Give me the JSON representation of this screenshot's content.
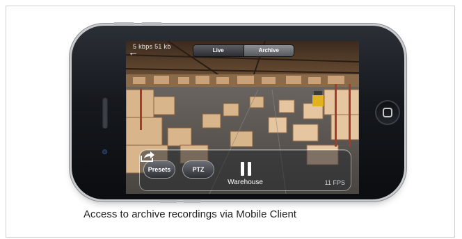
{
  "status_bar": {
    "text": "5 kbps    51 kb"
  },
  "view_switch": {
    "live_label": "Live",
    "archive_label": "Archive",
    "selected": "Archive"
  },
  "controls": {
    "presets_label": "Presets",
    "ptz_label": "PTZ",
    "camera_name": "Warehouse",
    "fps": "11 FPS"
  },
  "caption": "Access to archive recordings via Mobile Client",
  "icons": [
    "back-arrow-icon",
    "pause-icon",
    "share-icon",
    "home-button-icon"
  ],
  "colors": {
    "phone_body": "#15181d",
    "control_bar": "#2c3036",
    "archive_segment": "#6e7176"
  }
}
